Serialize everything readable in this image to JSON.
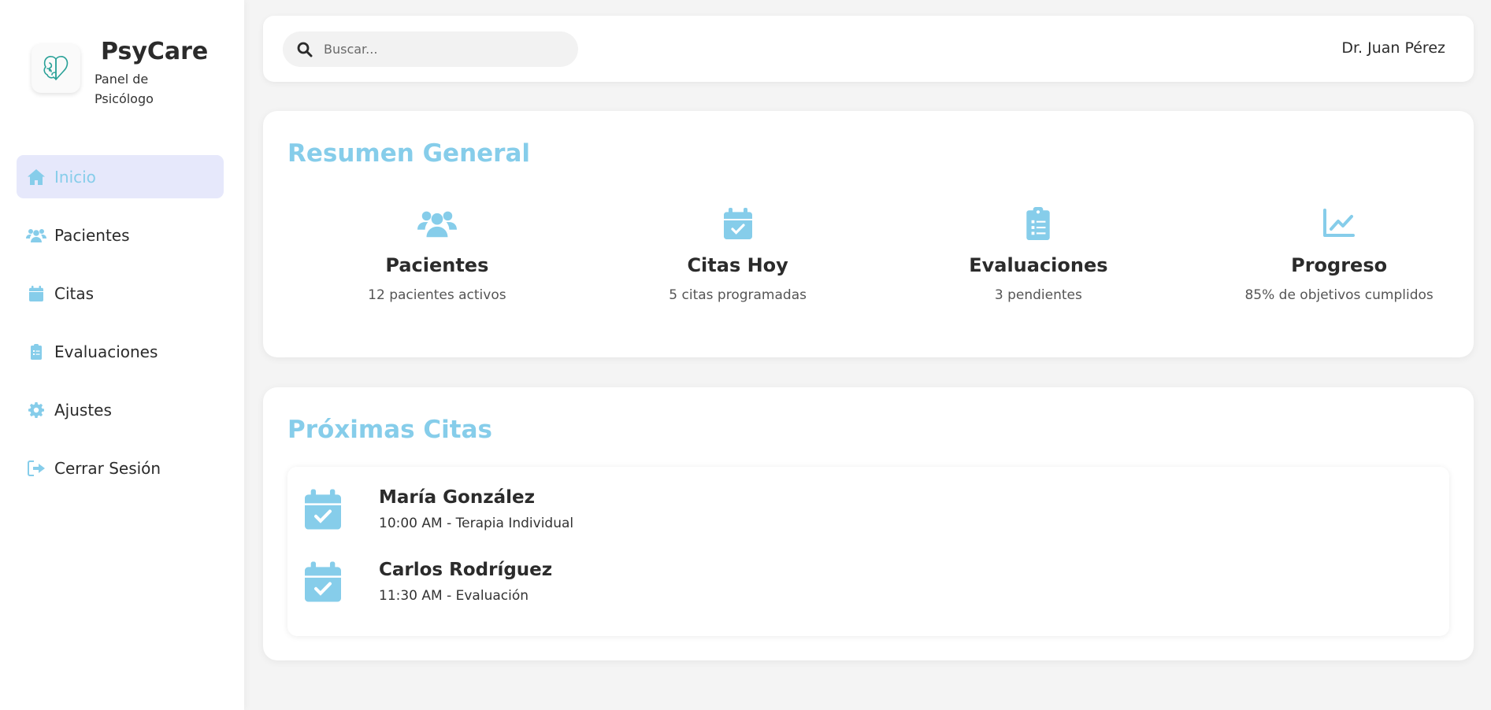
{
  "brand": {
    "name": "PsyCare",
    "subtitle": "Panel de Psicólogo",
    "logo_icon": "brain-heart-icon"
  },
  "sidebar": {
    "items": [
      {
        "label": "Inicio",
        "icon": "home-icon",
        "active": true
      },
      {
        "label": "Pacientes",
        "icon": "users-icon",
        "active": false
      },
      {
        "label": "Citas",
        "icon": "calendar-icon",
        "active": false
      },
      {
        "label": "Evaluaciones",
        "icon": "clipboard-list-icon",
        "active": false
      },
      {
        "label": "Ajustes",
        "icon": "gear-icon",
        "active": false
      },
      {
        "label": "Cerrar Sesión",
        "icon": "logout-icon",
        "active": false
      }
    ]
  },
  "search": {
    "placeholder": "Buscar...",
    "value": ""
  },
  "user": {
    "name": "Dr. Juan Pérez"
  },
  "summary": {
    "title": "Resumen General",
    "stats": [
      {
        "title": "Pacientes",
        "desc": "12 pacientes activos",
        "icon": "users-icon"
      },
      {
        "title": "Citas Hoy",
        "desc": "5 citas programadas",
        "icon": "calendar-check-icon"
      },
      {
        "title": "Evaluaciones",
        "desc": "3 pendientes",
        "icon": "clipboard-list-icon"
      },
      {
        "title": "Progreso",
        "desc": "85% de objetivos cumplidos",
        "icon": "chart-line-icon"
      }
    ]
  },
  "upcoming": {
    "title": "Próximas Citas",
    "appointments": [
      {
        "name": "María González",
        "detail": "10:00 AM - Terapia Individual",
        "icon": "calendar-check-icon"
      },
      {
        "name": "Carlos Rodríguez",
        "detail": "11:30 AM - Evaluación",
        "icon": "calendar-check-icon"
      }
    ]
  },
  "colors": {
    "accent": "#86cdea",
    "active_bg": "#e6e8fb",
    "background": "#f4f4f4",
    "logo_stroke": "#2aa198"
  }
}
